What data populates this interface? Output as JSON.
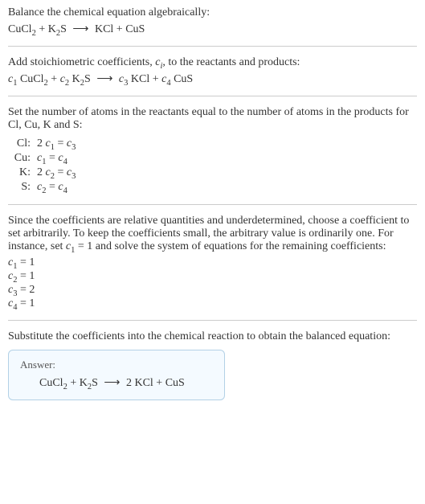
{
  "section1": {
    "title": "Balance the chemical equation algebraically:",
    "equation": "CuCl₂ + K₂S ⟶ KCl + CuS"
  },
  "section2": {
    "title_a": "Add stoichiometric coefficients, ",
    "title_ci": "cᵢ",
    "title_b": ", to the reactants and products:",
    "equation": "c₁ CuCl₂ + c₂ K₂S ⟶ c₃ KCl + c₄ CuS"
  },
  "section3": {
    "title": "Set the number of atoms in the reactants equal to the number of atoms in the products for Cl, Cu, K and S:",
    "rows": [
      {
        "label": "Cl:",
        "eq": "2 c₁ = c₃"
      },
      {
        "label": "Cu:",
        "eq": "c₁ = c₄"
      },
      {
        "label": "K:",
        "eq": "2 c₂ = c₃"
      },
      {
        "label": "S:",
        "eq": "c₂ = c₄"
      }
    ]
  },
  "section4": {
    "title": "Since the coefficients are relative quantities and underdetermined, choose a coefficient to set arbitrarily. To keep the coefficients small, the arbitrary value is ordinarily one. For instance, set c₁ = 1 and solve the system of equations for the remaining coefficients:",
    "coeffs": [
      "c₁ = 1",
      "c₂ = 1",
      "c₃ = 2",
      "c₄ = 1"
    ]
  },
  "section5": {
    "title": "Substitute the coefficients into the chemical reaction to obtain the balanced equation:",
    "answer_label": "Answer:",
    "answer_eq": "CuCl₂ + K₂S ⟶ 2 KCl + CuS"
  },
  "chart_data": {
    "type": "table",
    "title": "Balancing CuCl2 + K2S → KCl + CuS",
    "unbalanced_equation": "CuCl2 + K2S → KCl + CuS",
    "element_balance": [
      {
        "element": "Cl",
        "equation": "2 c1 = c3"
      },
      {
        "element": "Cu",
        "equation": "c1 = c4"
      },
      {
        "element": "K",
        "equation": "2 c2 = c3"
      },
      {
        "element": "S",
        "equation": "c2 = c4"
      }
    ],
    "solution": {
      "c1": 1,
      "c2": 1,
      "c3": 2,
      "c4": 1
    },
    "balanced_equation": "CuCl2 + K2S → 2 KCl + CuS"
  }
}
